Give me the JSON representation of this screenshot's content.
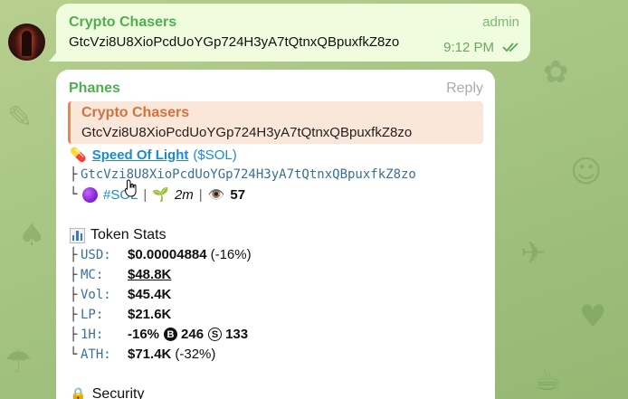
{
  "colors": {
    "bubble_out": "#effdde",
    "bubble_in": "#ffffff",
    "sender_green": "#4fae4e",
    "quote_orange": "#d2733d",
    "link_blue": "#1c8ad0"
  },
  "top_message": {
    "sender": "Crypto Chasers",
    "role": "admin",
    "text": "GtcVzi8U8XioPcdUoYGp724H3yA7tQtnxQBpuxfkZ8zo",
    "time": "9:12 PM",
    "status_icon": "double-check-icon"
  },
  "main_message": {
    "sender": "Phanes",
    "reply_label": "Reply",
    "quote": {
      "sender": "Crypto Chasers",
      "text": "GtcVzi8U8XioPcdUoYGp724H3yA7tQtnxQBpuxfkZ8zo"
    },
    "token": {
      "pill_icon": "💊",
      "name": "Speed Of Light",
      "ticker": "($SOL)",
      "address": "GtcVzi8U8XioPcdUoYGp724H3yA7tQtnxQBpuxfkZ8zo",
      "hashtag": "#SOL",
      "seedling_icon": "🌱",
      "age": "2m",
      "eye_icon": "👁️",
      "views": "57"
    },
    "stats": {
      "title": "Token Stats",
      "rows": [
        {
          "tree": "├",
          "label": "USD:",
          "value": "$0.00004884",
          "extra": "(-16%)"
        },
        {
          "tree": "├",
          "label": "MC:",
          "value": "$48.8K",
          "extra": ""
        },
        {
          "tree": "├",
          "label": "Vol:",
          "value": "$45.4K",
          "extra": ""
        },
        {
          "tree": "├",
          "label": "LP:",
          "value": "$21.6K",
          "extra": ""
        },
        {
          "tree": "├",
          "label": "1H:",
          "value": "-16%",
          "buys": "246",
          "sells": "133"
        },
        {
          "tree": "└",
          "label": "ATH:",
          "value": "$71.4K",
          "extra": "(-32%)"
        }
      ]
    },
    "security_icon": "🔒",
    "security_title": "Security"
  }
}
